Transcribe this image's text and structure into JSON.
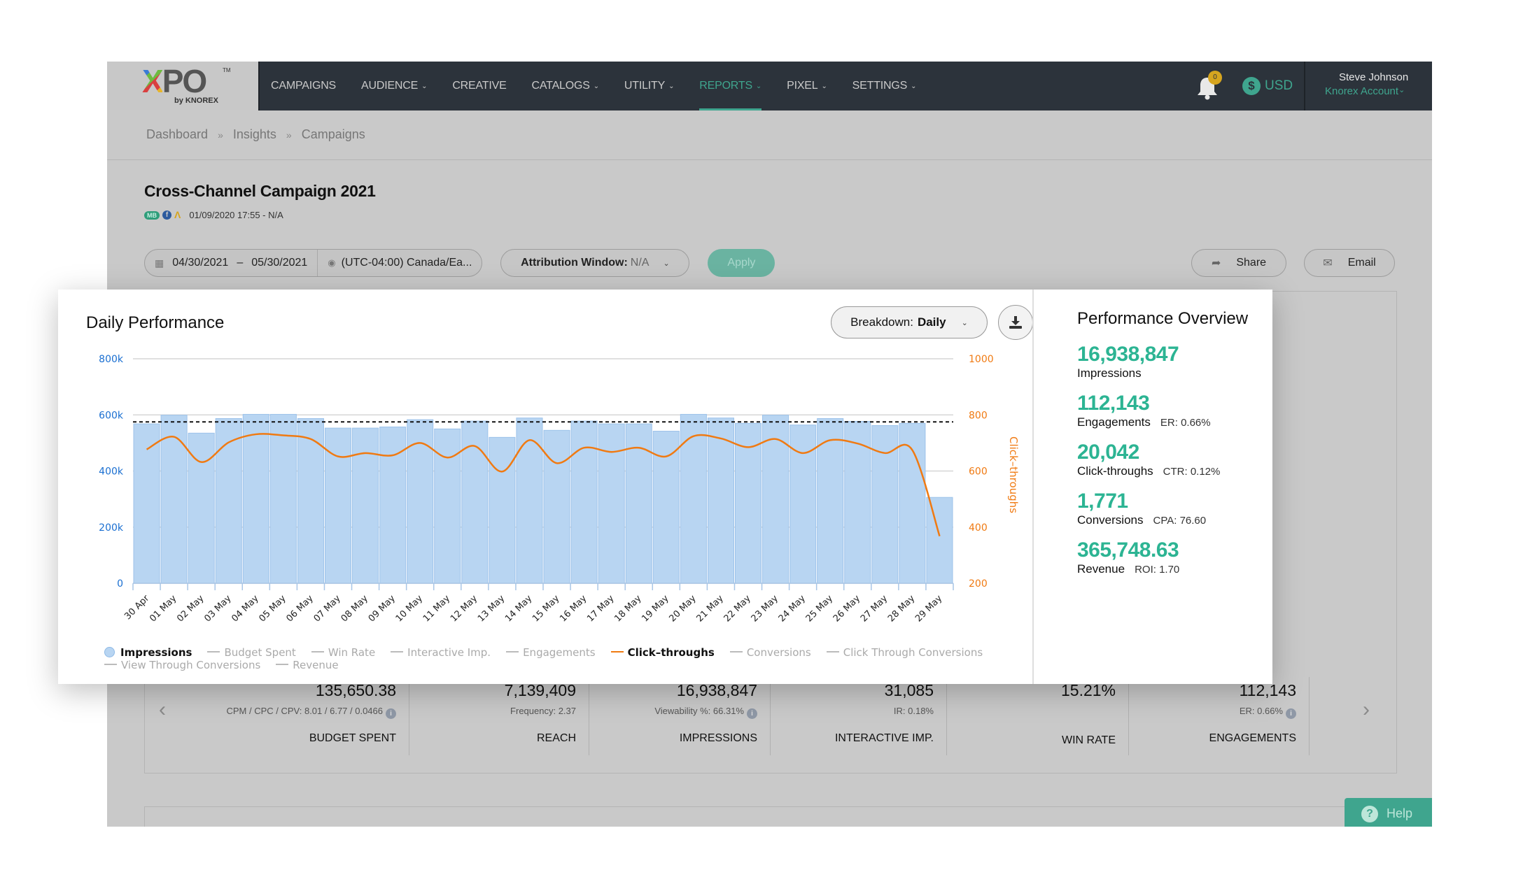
{
  "brand": {
    "logo_main": "XPO",
    "logo_x": "X",
    "logo_rest": "PO",
    "logo_tm": "TM",
    "logo_sub": "by KNOREX"
  },
  "nav": {
    "items": [
      {
        "label": "CAMPAIGNS",
        "dropdown": false,
        "active": false
      },
      {
        "label": "AUDIENCE",
        "dropdown": true,
        "active": false
      },
      {
        "label": "CREATIVE",
        "dropdown": false,
        "active": false
      },
      {
        "label": "CATALOGS",
        "dropdown": true,
        "active": false
      },
      {
        "label": "UTILITY",
        "dropdown": true,
        "active": false
      },
      {
        "label": "REPORTS",
        "dropdown": true,
        "active": true
      },
      {
        "label": "PIXEL",
        "dropdown": true,
        "active": false
      },
      {
        "label": "SETTINGS",
        "dropdown": true,
        "active": false
      }
    ],
    "notification_count": "0",
    "currency": "USD",
    "currency_symbol": "$",
    "user_name": "Steve Johnson",
    "account": "Knorex Account"
  },
  "breadcrumb": [
    "Dashboard",
    "Insights",
    "Campaigns"
  ],
  "breadcrumb_sep": "»",
  "campaign": {
    "title": "Cross-Channel Campaign 2021",
    "badge": "MB",
    "fb_glyph": "f",
    "ga_glyph": "Λ",
    "date_range_text": "01/09/2020 17:55 - N/A"
  },
  "filters": {
    "start_date": "04/30/2021",
    "date_sep": "–",
    "end_date": "05/30/2021",
    "timezone": "(UTC-04:00) Canada/Ea...",
    "attribution_label": "Attribution Window:",
    "attribution_value": "N/A",
    "apply": "Apply",
    "share": "Share",
    "email": "Email"
  },
  "daily_performance": {
    "title": "Daily Performance",
    "breakdown_label": "Breakdown:",
    "breakdown_value": "Daily"
  },
  "chart_data": {
    "type": "bar",
    "title": "Daily Performance",
    "xlabel": "",
    "ylabel": "Impressions",
    "y2label": "Click–throughs",
    "ylim": [
      0,
      800000
    ],
    "y2lim": [
      200,
      1000
    ],
    "yticks": [
      "0",
      "200k",
      "400k",
      "600k",
      "800k"
    ],
    "y2ticks": [
      "200",
      "400",
      "600",
      "800",
      "1000"
    ],
    "grid": true,
    "average_line": 575000,
    "categories": [
      "30 Apr",
      "01 May",
      "02 May",
      "03 May",
      "04 May",
      "05 May",
      "06 May",
      "07 May",
      "08 May",
      "09 May",
      "10 May",
      "11 May",
      "12 May",
      "13 May",
      "14 May",
      "15 May",
      "16 May",
      "17 May",
      "18 May",
      "19 May",
      "20 May",
      "21 May",
      "22 May",
      "23 May",
      "24 May",
      "25 May",
      "26 May",
      "27 May",
      "28 May",
      "29 May"
    ],
    "series": [
      {
        "name": "Impressions",
        "type": "bar",
        "axis": "left",
        "color": "#b8d5f2",
        "values": [
          568000,
          599000,
          535000,
          587000,
          602000,
          602000,
          587000,
          553000,
          553000,
          557000,
          583000,
          550000,
          578000,
          520000,
          589000,
          545000,
          578000,
          568000,
          568000,
          542000,
          602000,
          589000,
          570000,
          599000,
          564000,
          587000,
          577000,
          562000,
          570000,
          306000
        ]
      },
      {
        "name": "Click–throughs",
        "type": "line",
        "axis": "right",
        "color": "#f07a12",
        "values": [
          677,
          722,
          632,
          702,
          731,
          727,
          714,
          652,
          664,
          656,
          700,
          648,
          689,
          598,
          710,
          628,
          683,
          668,
          683,
          652,
          724,
          716,
          685,
          714,
          664,
          710,
          698,
          664,
          675,
          368
        ]
      }
    ],
    "legend": [
      {
        "label": "Impressions",
        "active": true,
        "marker": "dot"
      },
      {
        "label": "Budget Spent",
        "active": false,
        "marker": "line"
      },
      {
        "label": "Win Rate",
        "active": false,
        "marker": "line"
      },
      {
        "label": "Interactive Imp.",
        "active": false,
        "marker": "line"
      },
      {
        "label": "Engagements",
        "active": false,
        "marker": "line"
      },
      {
        "label": "Click–throughs",
        "active": true,
        "marker": "line",
        "color": "#f07a12"
      },
      {
        "label": "Conversions",
        "active": false,
        "marker": "line"
      },
      {
        "label": "Click Through Conversions",
        "active": false,
        "marker": "line"
      },
      {
        "label": "View Through Conversions",
        "active": false,
        "marker": "line"
      },
      {
        "label": "Revenue",
        "active": false,
        "marker": "line"
      }
    ],
    "legend_position": "bottom"
  },
  "overview": {
    "title": "Performance Overview",
    "items": [
      {
        "value": "16,938,847",
        "label": "Impressions",
        "ratio": ""
      },
      {
        "value": "112,143",
        "label": "Engagements",
        "ratio": "ER: 0.66%"
      },
      {
        "value": "20,042",
        "label": "Click-throughs",
        "ratio": "CTR: 0.12%"
      },
      {
        "value": "1,771",
        "label": "Conversions",
        "ratio": "CPA: 76.60"
      },
      {
        "value": "365,748.63",
        "label": "Revenue",
        "ratio": "ROI: 1.70"
      }
    ]
  },
  "stats": [
    {
      "value": "135,650.38",
      "sub": "CPM / CPC / CPV: 8.01 / 6.77 / 0.0466",
      "info": true,
      "label": "BUDGET SPENT"
    },
    {
      "value": "7,139,409",
      "sub": "Frequency: 2.37",
      "info": false,
      "label": "REACH"
    },
    {
      "value": "16,938,847",
      "sub": "Viewability %: 66.31%",
      "info": true,
      "label": "IMPRESSIONS"
    },
    {
      "value": "31,085",
      "sub": "IR: 0.18%",
      "info": false,
      "label": "INTERACTIVE IMP."
    },
    {
      "value": "15.21%",
      "sub": "",
      "info": false,
      "label": "WIN RATE"
    },
    {
      "value": "112,143",
      "sub": "ER: 0.66%",
      "info": true,
      "label": "ENGAGEMENTS"
    }
  ],
  "stats_nav": {
    "prev": "‹",
    "next": "›",
    "info_glyph": "i"
  },
  "help": {
    "label": "Help",
    "glyph": "?"
  },
  "colors": {
    "accent": "#3fa58e",
    "impressions": "#b8d5f2",
    "click_throughs": "#f07a12",
    "left_axis": "#1a6fd1",
    "overview_value": "#2cb493"
  }
}
